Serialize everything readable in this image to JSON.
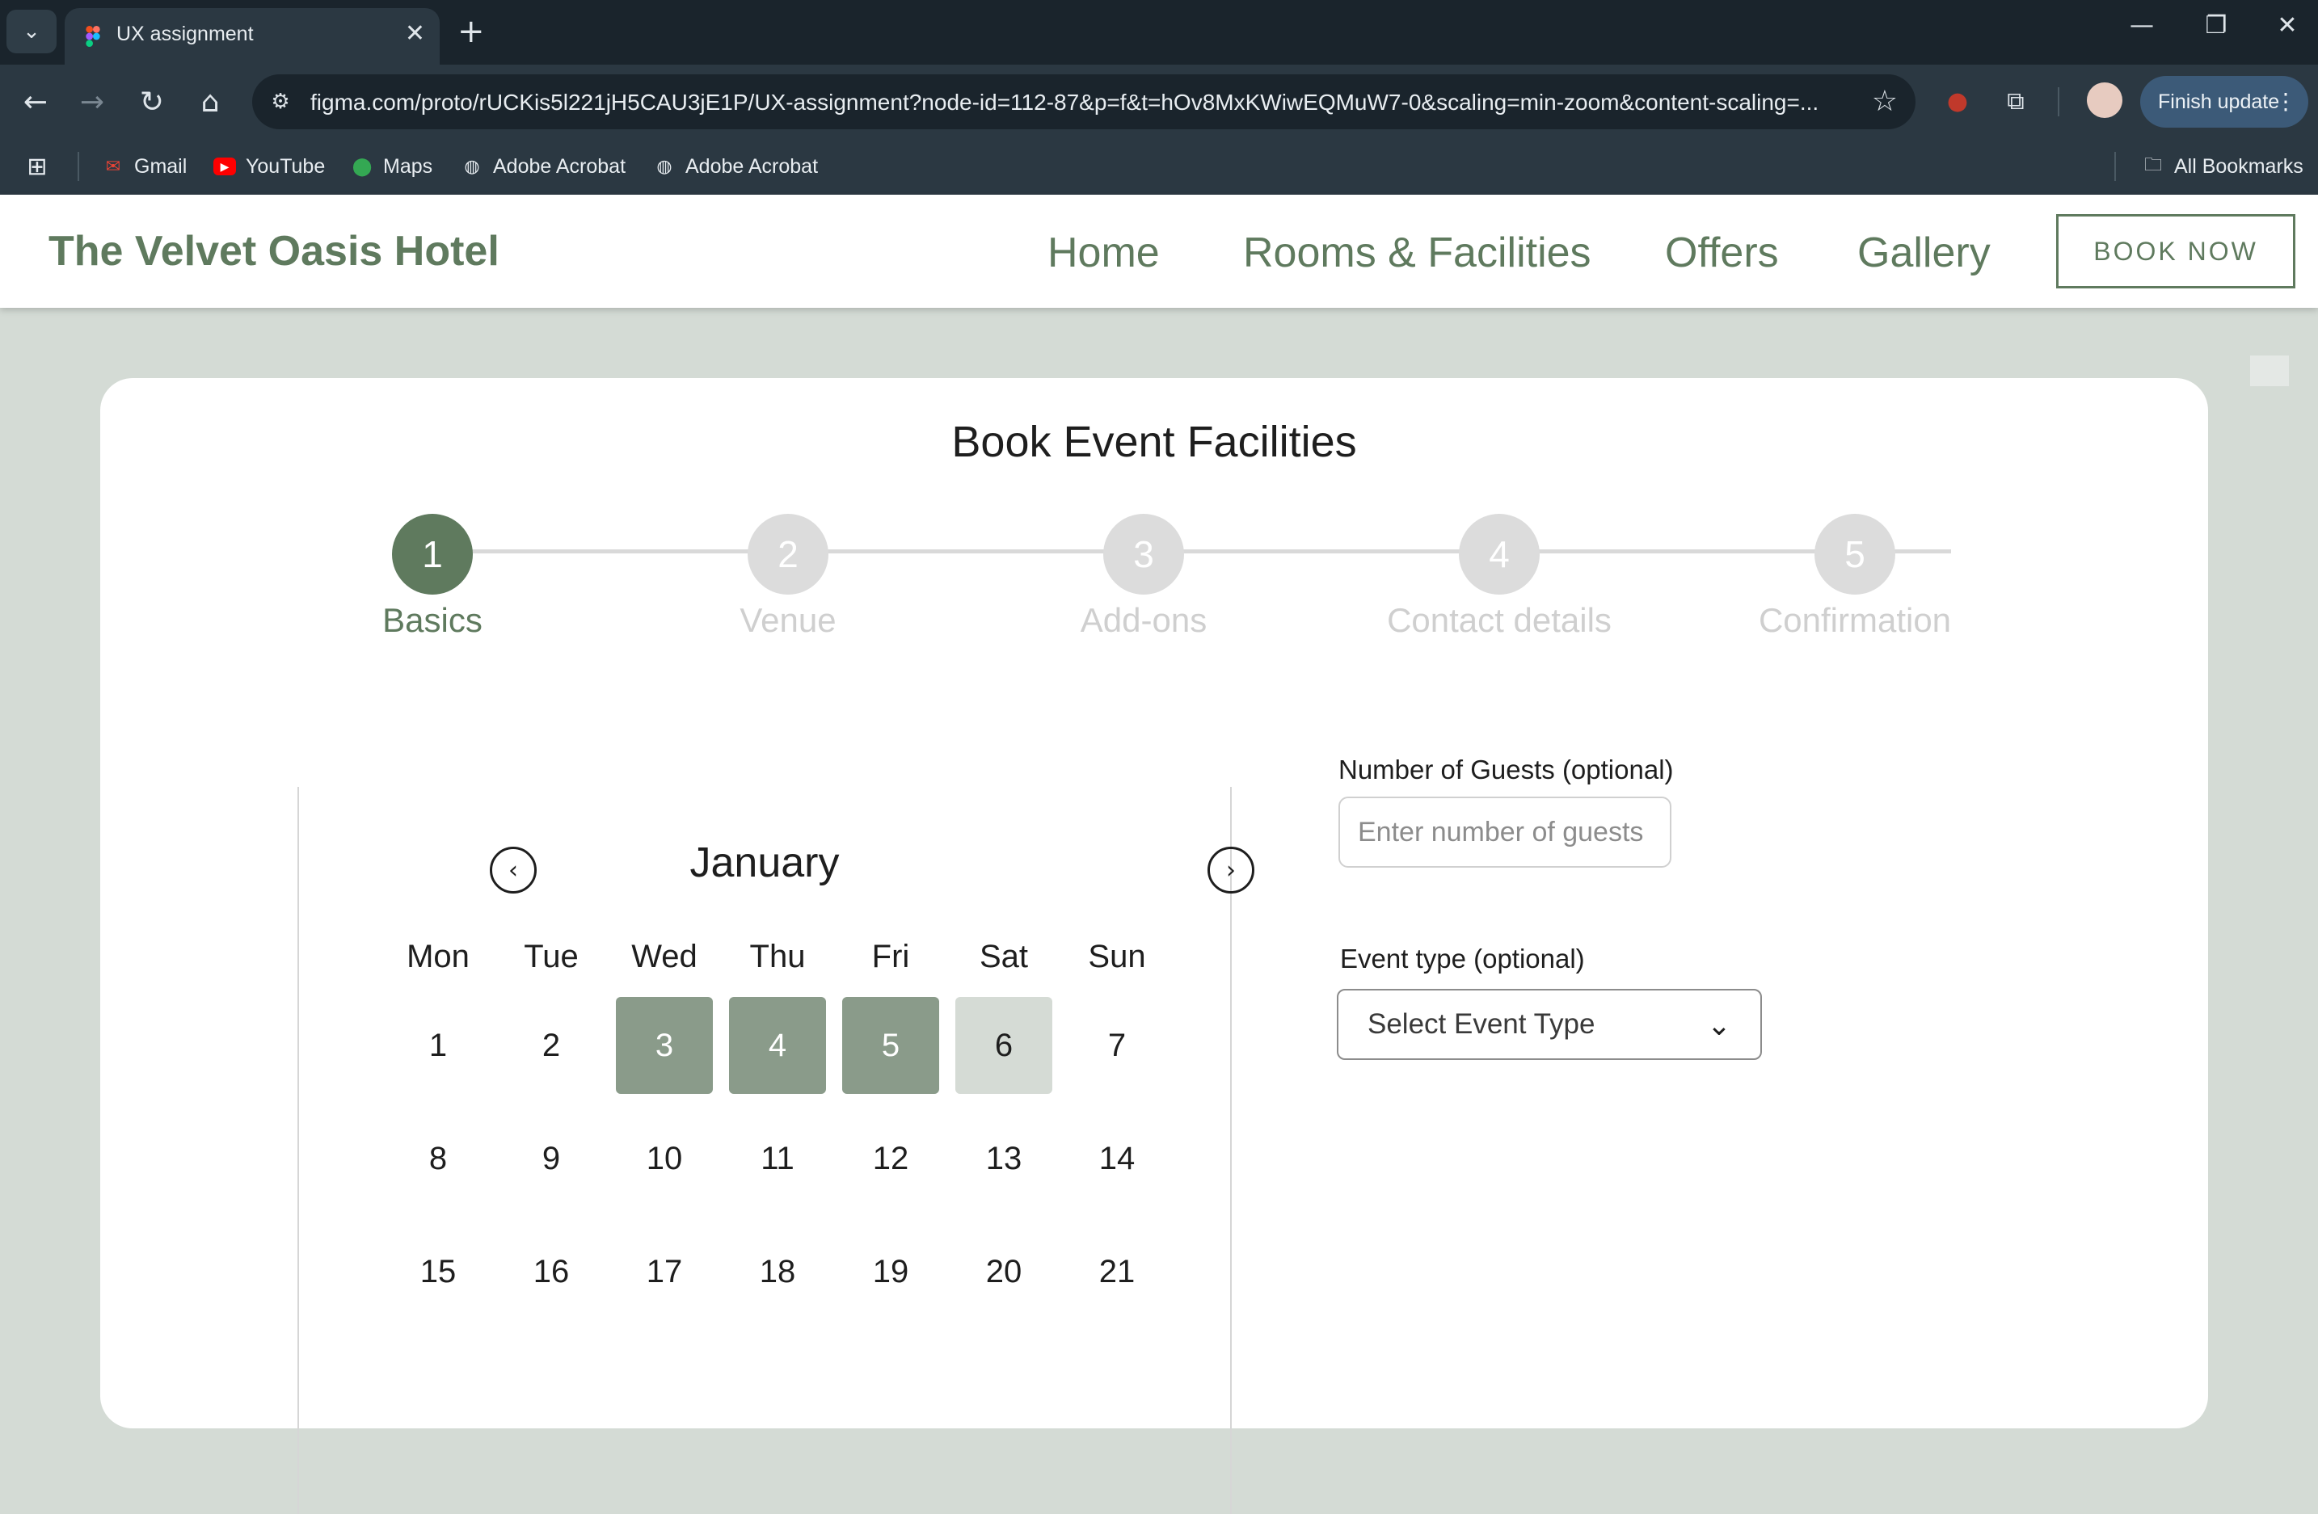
{
  "browser": {
    "tab_title": "UX assignment",
    "url": "figma.com/proto/rUCKis5l221jH5CAU3jE1P/UX-assignment?node-id=112-87&p=f&t=hOv8MxKWiwEQMuW7-0&scaling=min-zoom&content-scaling=...",
    "finish_update_label": "Finish update",
    "bookmarks": [
      {
        "label": "Gmail",
        "icon": "gmail-icon"
      },
      {
        "label": "YouTube",
        "icon": "youtube-icon"
      },
      {
        "label": "Maps",
        "icon": "maps-icon"
      },
      {
        "label": "Adobe Acrobat",
        "icon": "globe-icon"
      },
      {
        "label": "Adobe Acrobat",
        "icon": "globe-icon"
      }
    ],
    "all_bookmarks_label": "All Bookmarks"
  },
  "site": {
    "brand": "The Velvet Oasis Hotel",
    "nav": [
      "Home",
      "Rooms & Facilities",
      "Offers",
      "Gallery"
    ],
    "book_now": "BOOK NOW",
    "accent_color": "#5f7a5e"
  },
  "booking": {
    "title": "Book Event Facilities",
    "steps": [
      {
        "number": "1",
        "label": "Basics",
        "active": true
      },
      {
        "number": "2",
        "label": "Venue",
        "active": false
      },
      {
        "number": "3",
        "label": "Add-ons",
        "active": false
      },
      {
        "number": "4",
        "label": "Contact details",
        "active": false
      },
      {
        "number": "5",
        "label": "Confirmation",
        "active": false
      }
    ],
    "calendar": {
      "month": "January",
      "weekdays": [
        "Mon",
        "Tue",
        "Wed",
        "Thu",
        "Fri",
        "Sat",
        "Sun"
      ],
      "weeks": [
        [
          "1",
          "2",
          "3",
          "4",
          "5",
          "6",
          "7"
        ],
        [
          "8",
          "9",
          "10",
          "11",
          "12",
          "13",
          "14"
        ],
        [
          "15",
          "16",
          "17",
          "18",
          "19",
          "20",
          "21"
        ]
      ],
      "selected_days": [
        "3",
        "4",
        "5"
      ],
      "range_end_day": "6"
    },
    "guests": {
      "label": "Number of Guests (optional)",
      "placeholder": "Enter number of guests",
      "value": ""
    },
    "event_type": {
      "label": "Event type (optional)",
      "selected": "Select Event Type"
    }
  }
}
